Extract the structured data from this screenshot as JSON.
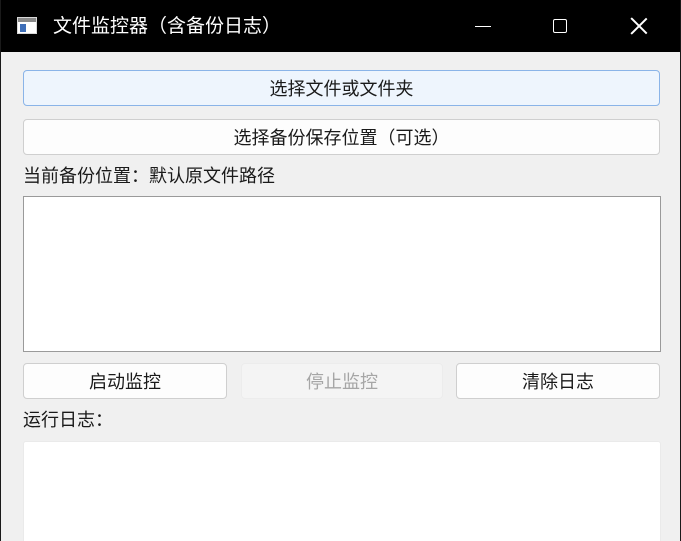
{
  "window": {
    "title": "文件监控器（含备份日志）"
  },
  "buttons": {
    "select_files": "选择文件或文件夹",
    "select_backup": "选择备份保存位置（可选）",
    "start_monitor": "启动监控",
    "stop_monitor": "停止监控",
    "clear_log": "清除日志"
  },
  "labels": {
    "current_backup": "当前备份位置：默认原文件路径",
    "run_log": "运行日志："
  },
  "file_list": {
    "items": []
  },
  "colors": {
    "titlebar": "#000000",
    "focus_border": "#8ab4e8",
    "disabled_text": "#a6a6a6"
  },
  "states": {
    "stop_monitor_enabled": false
  }
}
